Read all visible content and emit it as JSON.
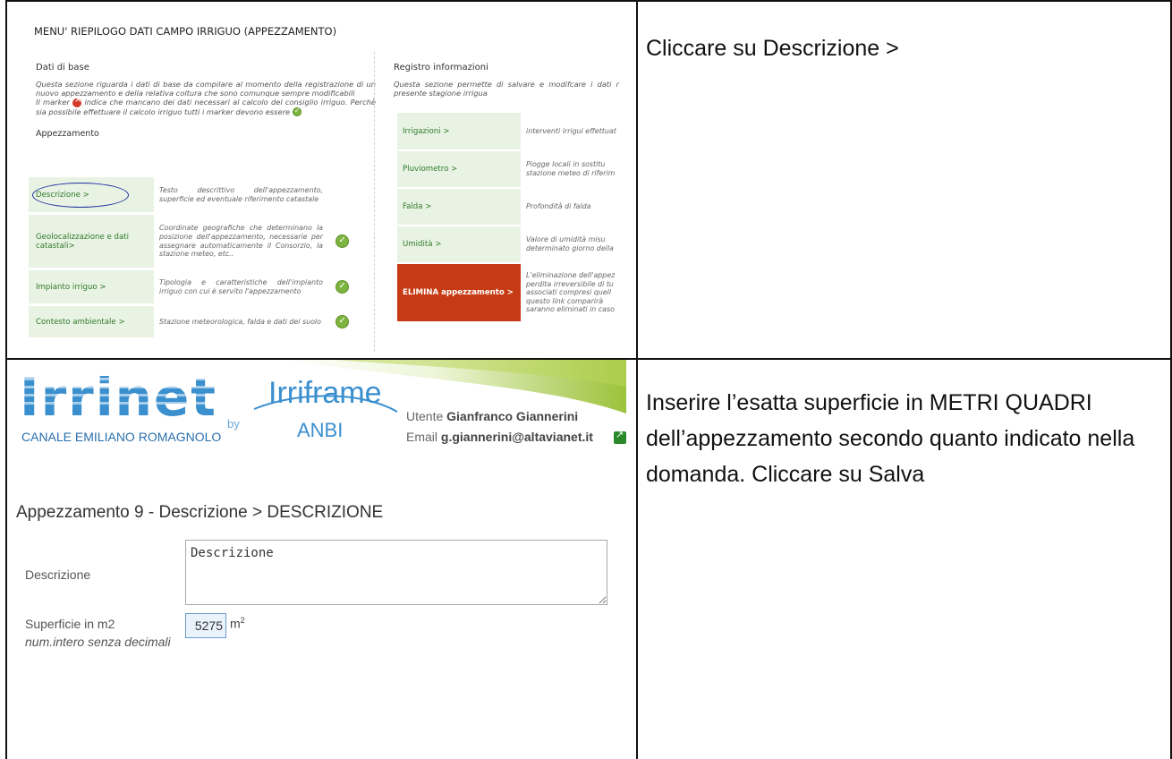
{
  "instructions": {
    "step1": "Cliccare su Descrizione >",
    "step2": "Inserire l’esatta superficie in METRI QUADRI dell’appezzamento secondo quanto indicato nella domanda. Cliccare su Salva"
  },
  "menu": {
    "title": "MENU' RIEPILOGO DATI CAMPO IRRIGUO (APPEZZAMENTO)",
    "base": {
      "heading": "Dati di base",
      "desc1": "Questa sezione riguarda i dati di base da compilare al momento della registrazione di un nuovo appezzamento e della relativa coltura che sono comunque sempre modificabili",
      "desc2a": "Il marker",
      "desc2b": "indica che mancano dei dati necessari al calcolo del consiglio irriguo. Perchè sia possibile effettuare il calcolo irriguo tutti i marker devono essere",
      "sub": "Appezzamento",
      "rows": [
        {
          "label": "Descrizione >",
          "desc": "Testo descrittivo dell'appezzamento, superficie ed eventuale riferimento catastale",
          "marker": "none"
        },
        {
          "label": "Geolocalizzazione e dati catastali>",
          "desc": "Coordinate geografiche che determinano la posizione dell'appezzamento, necessarie per assegnare automaticamente il Consorzio, la stazione meteo, etc..",
          "marker": "green-check-icon"
        },
        {
          "label": "Impianto irriguo >",
          "desc": "Tipologia e caratteristiche dell'impianto irriguo con cui è servito l'appezzamento",
          "marker": "green-check-icon"
        },
        {
          "label": "Contesto ambientale >",
          "desc": "Stazione meteorologica, falda e dati del suolo",
          "marker": "green-check-icon"
        }
      ]
    },
    "registro": {
      "heading": "Registro informazioni",
      "desc": "Questa sezione permette di salvare e modifcare i dati r presente stagione irrigua",
      "rows": [
        {
          "label": "Irrigazioni >",
          "desc": "interventi irrigui effettuat"
        },
        {
          "label": "Pluviometro >",
          "desc": "Piogge locali in sostitu stazione meteo di riferim"
        },
        {
          "label": "Falda >",
          "desc": "Profondità di falda"
        },
        {
          "label": "Umidità >",
          "desc": "Valore di umidità misu determinato giorno della"
        },
        {
          "label": "ELIMINA appezzamento >",
          "desc": "L'eliminazione dell'appez perdita irreversibile di tu associati compresi quell questo link comparirà saranno eliminati in caso"
        }
      ]
    }
  },
  "form": {
    "header": {
      "logo_main": "Irrinet",
      "logo_sub": "CANALE EMILIANO ROMAGNOLO",
      "by": "by",
      "logo2": "Irriframe",
      "logo2_sub": "ANBI",
      "user_prefix": "Utente",
      "user_name": "Gianfranco Giannerini",
      "email_prefix": "Email",
      "email": "g.giannerini@altavianet.it"
    },
    "page_title": "Appezzamento 9 - Descrizione > DESCRIZIONE",
    "descrizione_label": "Descrizione",
    "descrizione_value": "Descrizione",
    "superficie_label": "Superficie in m2",
    "superficie_hint": "num.intero senza decimali",
    "superficie_value": "5275",
    "unit": "m",
    "unit_exp": "2"
  },
  "colors": {
    "green_cell": "#e9f3e3",
    "green_text": "#2f7a2c",
    "danger": "#c63b14",
    "brand_blue": "#3a8fcf"
  }
}
